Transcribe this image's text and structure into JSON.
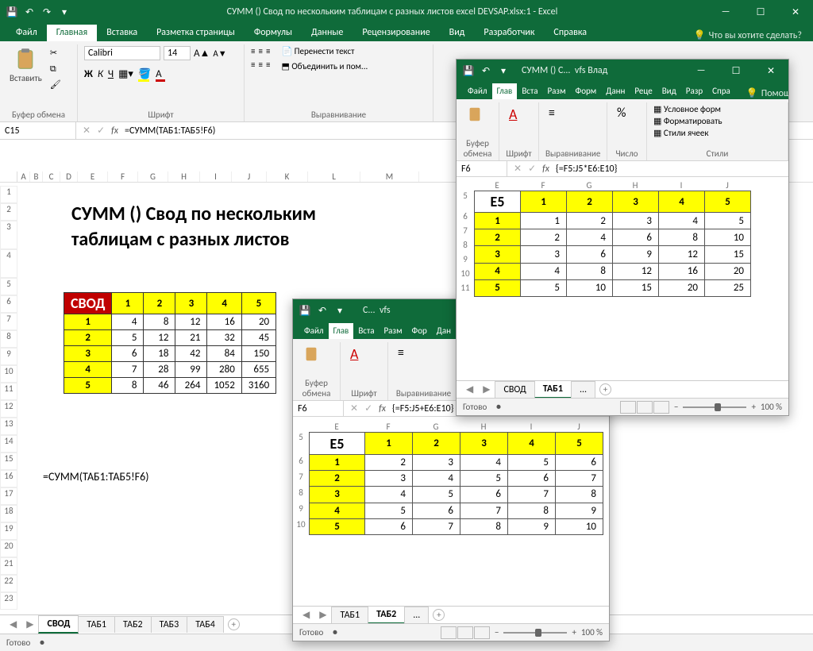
{
  "main": {
    "title": "СУММ () Свод по нескольким таблицам с разных листов excel DEVSAP.xlsx:1  -  Excel",
    "tabs": [
      "Файл",
      "Главная",
      "Вставка",
      "Разметка страницы",
      "Формулы",
      "Данные",
      "Рецензирование",
      "Вид",
      "Разработчик",
      "Справка"
    ],
    "active_tab": "Главная",
    "tell_me": "Что вы хотите сделать?",
    "ribbon": {
      "paste": "Вставить",
      "clipboard": "Буфер обмена",
      "font_name": "Calibri",
      "font_size": "14",
      "font_group": "Шрифт",
      "align_group": "Выравнивание",
      "wrap": "Перенести текст",
      "merge": "Объединить и пом..."
    },
    "namebox": "C15",
    "formula": "=СУММ(ТАБ1:ТАБ5!F6)",
    "heading": "СУММ () Свод по нескольким\nтаблицам с разных листов",
    "formula_text": "=СУММ(ТАБ1:ТАБ5!F6)",
    "svod_corner": "СВОД",
    "svod_cols": [
      "1",
      "2",
      "3",
      "4",
      "5"
    ],
    "svod_rows": [
      {
        "h": "1",
        "c": [
          4,
          8,
          12,
          16,
          20
        ]
      },
      {
        "h": "2",
        "c": [
          5,
          12,
          21,
          32,
          45
        ]
      },
      {
        "h": "3",
        "c": [
          6,
          18,
          42,
          84,
          150
        ]
      },
      {
        "h": "4",
        "c": [
          7,
          28,
          99,
          280,
          655
        ]
      },
      {
        "h": "5",
        "c": [
          8,
          46,
          264,
          1052,
          3160
        ]
      }
    ],
    "col_letters": [
      "A",
      "B",
      "C",
      "D",
      "E",
      "F",
      "G",
      "H",
      "I",
      "J",
      "K",
      "L",
      "M"
    ],
    "row_nums": [
      1,
      2,
      3,
      4,
      5,
      6,
      7,
      8,
      9,
      10,
      11,
      12,
      13,
      14,
      15,
      16,
      17,
      18,
      19,
      20,
      21,
      22,
      23
    ],
    "sheet_tabs": [
      "СВОД",
      "ТАБ1",
      "ТАБ2",
      "ТАБ3",
      "ТАБ4"
    ],
    "active_sheet": "СВОД",
    "status": "Готово"
  },
  "child2": {
    "title_short": "С...",
    "user": "vfs",
    "tabs": [
      "Файл",
      "Глав",
      "Вста",
      "Разм",
      "Фор",
      "Дан"
    ],
    "active_tab": "Глав",
    "ribbon": {
      "clipboard": "Буфер\nобмена",
      "font": "Шрифт",
      "align": "Выравнивание"
    },
    "namebox": "F6",
    "formula": "{=F5:J5+E6:E10}",
    "corner": "E5",
    "cols": [
      "1",
      "2",
      "3",
      "4",
      "5"
    ],
    "col_letters": [
      "E",
      "F",
      "G",
      "H",
      "I",
      "J"
    ],
    "row_nums": [
      5,
      6,
      7,
      8,
      9,
      10
    ],
    "rows": [
      {
        "h": "1",
        "c": [
          2,
          3,
          4,
          5,
          6
        ]
      },
      {
        "h": "2",
        "c": [
          3,
          4,
          5,
          6,
          7
        ]
      },
      {
        "h": "3",
        "c": [
          4,
          5,
          6,
          7,
          8
        ]
      },
      {
        "h": "4",
        "c": [
          5,
          6,
          7,
          8,
          9
        ]
      },
      {
        "h": "5",
        "c": [
          6,
          7,
          8,
          9,
          10
        ]
      }
    ],
    "sheet_tabs": [
      "ТАБ1",
      "ТАБ2",
      "..."
    ],
    "active_sheet": "ТАБ2",
    "status": "Готово",
    "zoom": "100 %"
  },
  "child3": {
    "title_short": "СУММ () С...",
    "user": "vfs Влад",
    "tabs": [
      "Файл",
      "Глав",
      "Вста",
      "Разм",
      "Форм",
      "Данн",
      "Реце",
      "Вид",
      "Разр",
      "Спра"
    ],
    "active_tab": "Глав",
    "help": "Помощ",
    "ribbon": {
      "clipboard": "Буфер\nобмена",
      "font": "Шрифт",
      "align": "Выравнивание",
      "number": "Число",
      "cond": "Условное форм",
      "fmt": "Форматировать",
      "styles": "Стили ячеек",
      "styles_lbl": "Стили"
    },
    "namebox": "F6",
    "formula": "{=F5:J5*E6:E10}",
    "corner": "E5",
    "cols": [
      "1",
      "2",
      "3",
      "4",
      "5"
    ],
    "col_letters": [
      "E",
      "F",
      "G",
      "H",
      "I",
      "J"
    ],
    "row_nums": [
      5,
      6,
      7,
      8,
      9,
      10,
      11
    ],
    "rows": [
      {
        "h": "1",
        "c": [
          1,
          2,
          3,
          4,
          5
        ]
      },
      {
        "h": "2",
        "c": [
          2,
          4,
          6,
          8,
          10
        ]
      },
      {
        "h": "3",
        "c": [
          3,
          6,
          9,
          12,
          15
        ]
      },
      {
        "h": "4",
        "c": [
          4,
          8,
          12,
          16,
          20
        ]
      },
      {
        "h": "5",
        "c": [
          5,
          10,
          15,
          20,
          25
        ]
      }
    ],
    "sheet_tabs": [
      "СВОД",
      "ТАБ1",
      "..."
    ],
    "active_sheet": "ТАБ1",
    "status": "Готово",
    "zoom": "100 %"
  },
  "icons": {
    "bulb": "💡",
    "save": "💾",
    "undo": "↶",
    "redo": "↷",
    "dropdown": "▾",
    "min": "—",
    "max": "☐",
    "close": "✕",
    "cut": "✂",
    "copy": "⧉",
    "brush": "🖌"
  }
}
